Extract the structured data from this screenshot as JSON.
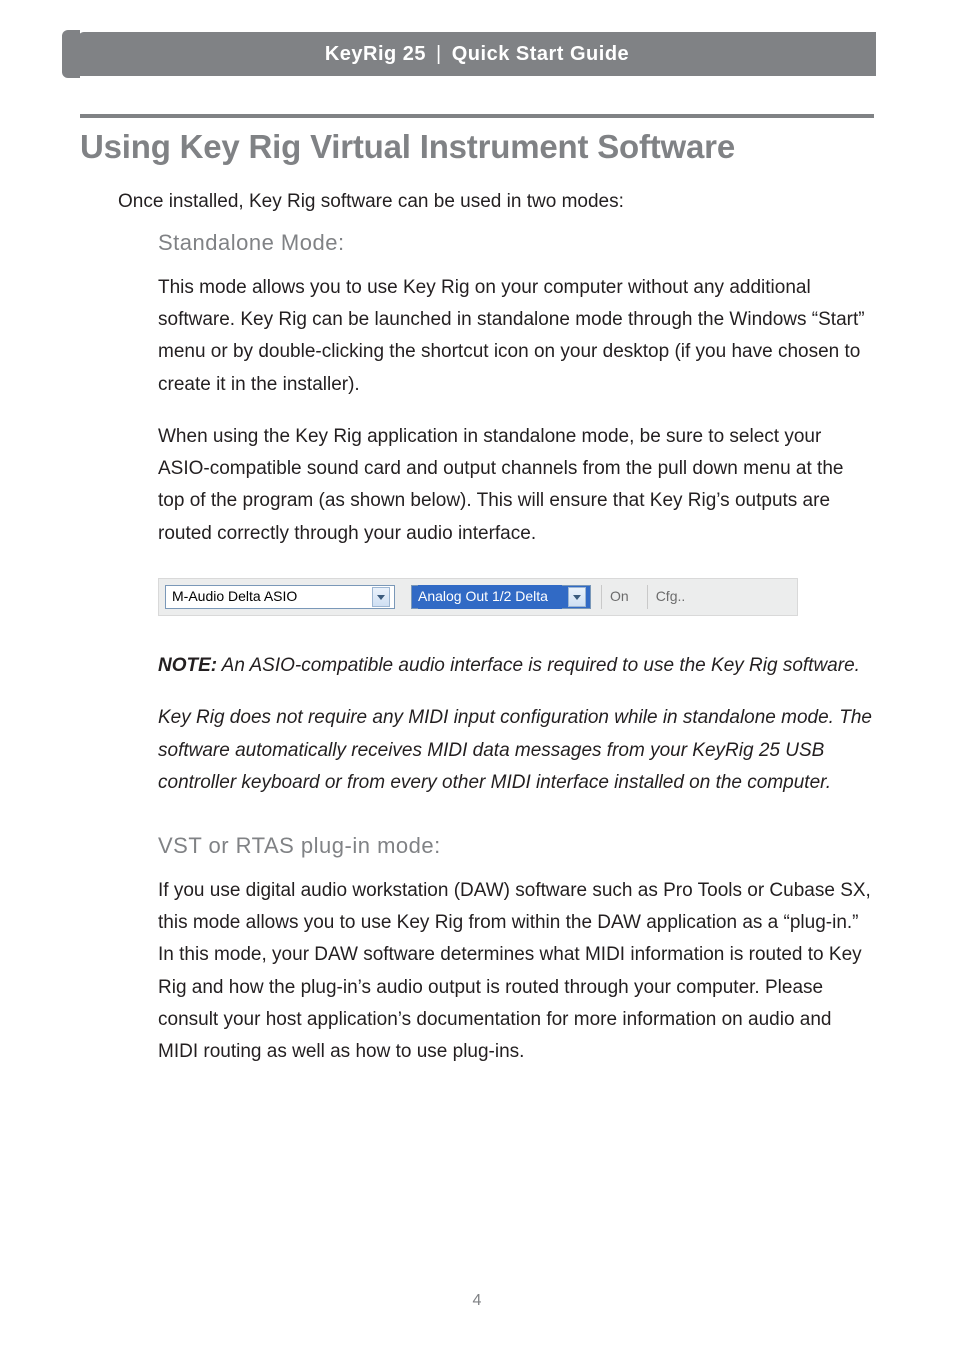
{
  "header": {
    "product": "KeyRig 25",
    "doc": "Quick Start Guide"
  },
  "h1": "Using Key Rig Virtual Instrument Software",
  "intro": "Once installed, Key Rig software can be used in two modes:",
  "standalone": {
    "title": "Standalone Mode:",
    "p1": "This mode allows you to use Key Rig on your computer without any additional software.  Key Rig can be launched in standalone mode through the Windows “Start” menu or by double-clicking the shortcut icon on your desktop (if you have chosen to create it in the installer).",
    "p2": "When using the Key Rig application in standalone mode, be sure to select your ASIO-compatible sound card and output channels from the pull down menu at the top of the program (as shown below). This will ensure that Key Rig’s outputs are routed correctly through your audio interface."
  },
  "toolbar": {
    "device": "M-Audio Delta ASIO",
    "output": "Analog Out 1/2 Delta",
    "on": "On",
    "cfg": "Cfg.."
  },
  "note": {
    "label": "NOTE:",
    "text": "  An ASIO-compatible audio interface is required to use the Key Rig software."
  },
  "note2": "Key Rig does not require any MIDI input configuration while in standalone mode.  The software automatically receives MIDI data messages from your KeyRig 25 USB controller keyboard or from every other MIDI interface installed on the computer.",
  "vst": {
    "title": "VST or RTAS plug-in mode:",
    "p1": "If you use digital audio workstation (DAW) software such as Pro Tools or Cubase SX, this mode allows you to use Key Rig from within the DAW application as a “plug-in.”  In this mode, your DAW software determines what MIDI information is routed to Key Rig and how the plug-in’s audio output is routed through your computer.  Please consult your host application’s documentation for more information on audio and MIDI routing as well as how to use plug-ins."
  },
  "page": "4"
}
